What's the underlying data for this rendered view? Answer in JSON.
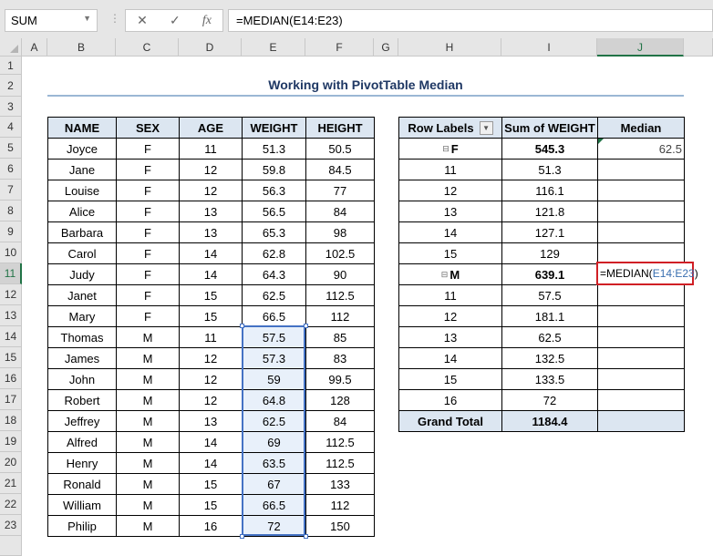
{
  "formula_bar": {
    "name_box": "SUM",
    "cancel_icon": "✕",
    "enter_icon": "✓",
    "fx_label": "fx",
    "formula": "=MEDIAN(E14:E23)"
  },
  "columns": [
    "A",
    "B",
    "C",
    "D",
    "E",
    "F",
    "G",
    "H",
    "I",
    "J"
  ],
  "rows": [
    "1",
    "2",
    "3",
    "4",
    "5",
    "6",
    "7",
    "8",
    "9",
    "10",
    "11",
    "12",
    "13",
    "14",
    "15",
    "16",
    "17",
    "18",
    "19",
    "20",
    "21",
    "22",
    "23"
  ],
  "title": "Working with PivotTable Median",
  "data_table": {
    "headers": [
      "NAME",
      "SEX",
      "AGE",
      "WEIGHT",
      "HEIGHT"
    ],
    "rows": [
      [
        "Joyce",
        "F",
        "11",
        "51.3",
        "50.5"
      ],
      [
        "Jane",
        "F",
        "12",
        "59.8",
        "84.5"
      ],
      [
        "Louise",
        "F",
        "12",
        "56.3",
        "77"
      ],
      [
        "Alice",
        "F",
        "13",
        "56.5",
        "84"
      ],
      [
        "Barbara",
        "F",
        "13",
        "65.3",
        "98"
      ],
      [
        "Carol",
        "F",
        "14",
        "62.8",
        "102.5"
      ],
      [
        "Judy",
        "F",
        "14",
        "64.3",
        "90"
      ],
      [
        "Janet",
        "F",
        "15",
        "62.5",
        "112.5"
      ],
      [
        "Mary",
        "F",
        "15",
        "66.5",
        "112"
      ],
      [
        "Thomas",
        "M",
        "11",
        "57.5",
        "85"
      ],
      [
        "James",
        "M",
        "12",
        "57.3",
        "83"
      ],
      [
        "John",
        "M",
        "12",
        "59",
        "99.5"
      ],
      [
        "Robert",
        "M",
        "12",
        "64.8",
        "128"
      ],
      [
        "Jeffrey",
        "M",
        "13",
        "62.5",
        "84"
      ],
      [
        "Alfred",
        "M",
        "14",
        "69",
        "112.5"
      ],
      [
        "Henry",
        "M",
        "14",
        "63.5",
        "112.5"
      ],
      [
        "Ronald",
        "M",
        "15",
        "67",
        "133"
      ],
      [
        "William",
        "M",
        "15",
        "66.5",
        "112"
      ],
      [
        "Philip",
        "M",
        "16",
        "72",
        "150"
      ]
    ]
  },
  "pivot": {
    "headers": [
      "Row Labels",
      "Sum of WEIGHT",
      "Median"
    ],
    "rows": [
      {
        "label": "F",
        "sum": "545.3",
        "median": "62.5",
        "group": true
      },
      {
        "label": "11",
        "sum": "51.3",
        "median": ""
      },
      {
        "label": "12",
        "sum": "116.1",
        "median": ""
      },
      {
        "label": "13",
        "sum": "121.8",
        "median": ""
      },
      {
        "label": "14",
        "sum": "127.1",
        "median": ""
      },
      {
        "label": "15",
        "sum": "129",
        "median": ""
      },
      {
        "label": "M",
        "sum": "639.1",
        "median": "",
        "group": true
      },
      {
        "label": "11",
        "sum": "57.5",
        "median": ""
      },
      {
        "label": "12",
        "sum": "181.1",
        "median": ""
      },
      {
        "label": "13",
        "sum": "62.5",
        "median": ""
      },
      {
        "label": "14",
        "sum": "132.5",
        "median": ""
      },
      {
        "label": "15",
        "sum": "133.5",
        "median": ""
      },
      {
        "label": "16",
        "sum": "72",
        "median": ""
      },
      {
        "label": "Grand Total",
        "sum": "1184.4",
        "median": "",
        "total": true
      }
    ],
    "editing": {
      "prefix": "=MEDIAN(",
      "ref": "E14:E23",
      "suffix": ")"
    }
  }
}
